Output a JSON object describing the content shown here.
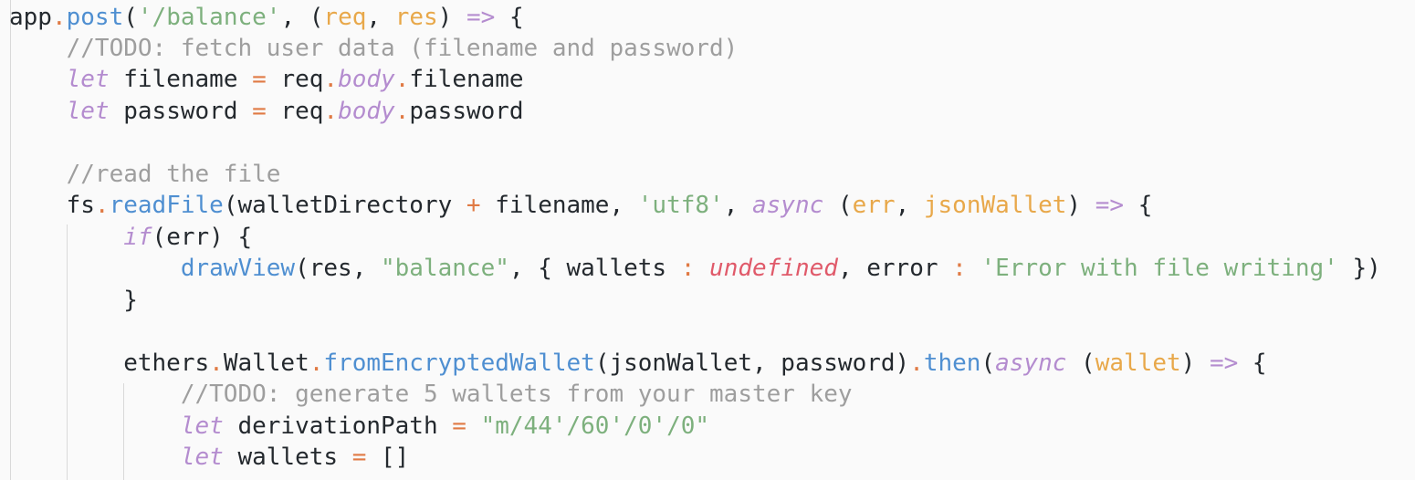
{
  "editor": {
    "lines": [
      {
        "tokens": [
          {
            "t": "app",
            "c": "punct"
          },
          {
            "t": ".",
            "c": "operator"
          },
          {
            "t": "post",
            "c": "function"
          },
          {
            "t": "(",
            "c": "punct"
          },
          {
            "t": "'/balance'",
            "c": "string"
          },
          {
            "t": ", ",
            "c": "punct"
          },
          {
            "t": "(",
            "c": "punct"
          },
          {
            "t": "req",
            "c": "param"
          },
          {
            "t": ", ",
            "c": "punct"
          },
          {
            "t": "res",
            "c": "param"
          },
          {
            "t": ") ",
            "c": "punct"
          },
          {
            "t": "=>",
            "c": "keyword"
          },
          {
            "t": " {",
            "c": "punct"
          }
        ]
      },
      {
        "tokens": [
          {
            "t": "    ",
            "c": "punct"
          },
          {
            "t": "//TODO: fetch user data (filename and password)",
            "c": "comment"
          }
        ]
      },
      {
        "tokens": [
          {
            "t": "    ",
            "c": "punct"
          },
          {
            "t": "let",
            "c": "keyword"
          },
          {
            "t": " filename ",
            "c": "punct"
          },
          {
            "t": "=",
            "c": "operator"
          },
          {
            "t": " req",
            "c": "punct"
          },
          {
            "t": ".",
            "c": "operator"
          },
          {
            "t": "body",
            "c": "prop"
          },
          {
            "t": ".",
            "c": "operator"
          },
          {
            "t": "filename",
            "c": "punct"
          }
        ]
      },
      {
        "tokens": [
          {
            "t": "    ",
            "c": "punct"
          },
          {
            "t": "let",
            "c": "keyword"
          },
          {
            "t": " password ",
            "c": "punct"
          },
          {
            "t": "=",
            "c": "operator"
          },
          {
            "t": " req",
            "c": "punct"
          },
          {
            "t": ".",
            "c": "operator"
          },
          {
            "t": "body",
            "c": "prop"
          },
          {
            "t": ".",
            "c": "operator"
          },
          {
            "t": "password",
            "c": "punct"
          }
        ]
      },
      {
        "tokens": []
      },
      {
        "tokens": [
          {
            "t": "    ",
            "c": "punct"
          },
          {
            "t": "//read the file",
            "c": "comment"
          }
        ]
      },
      {
        "tokens": [
          {
            "t": "    fs",
            "c": "punct"
          },
          {
            "t": ".",
            "c": "operator"
          },
          {
            "t": "readFile",
            "c": "function"
          },
          {
            "t": "(walletDirectory ",
            "c": "punct"
          },
          {
            "t": "+",
            "c": "operator"
          },
          {
            "t": " filename, ",
            "c": "punct"
          },
          {
            "t": "'utf8'",
            "c": "string"
          },
          {
            "t": ", ",
            "c": "punct"
          },
          {
            "t": "async",
            "c": "keyword"
          },
          {
            "t": " (",
            "c": "punct"
          },
          {
            "t": "err",
            "c": "param"
          },
          {
            "t": ", ",
            "c": "punct"
          },
          {
            "t": "jsonWallet",
            "c": "param"
          },
          {
            "t": ") ",
            "c": "punct"
          },
          {
            "t": "=>",
            "c": "keyword"
          },
          {
            "t": " {",
            "c": "punct"
          }
        ]
      },
      {
        "tokens": [
          {
            "t": "        ",
            "c": "punct"
          },
          {
            "t": "if",
            "c": "keyword"
          },
          {
            "t": "(err) {",
            "c": "punct"
          }
        ]
      },
      {
        "tokens": [
          {
            "t": "            ",
            "c": "punct"
          },
          {
            "t": "drawView",
            "c": "function"
          },
          {
            "t": "(res, ",
            "c": "punct"
          },
          {
            "t": "\"balance\"",
            "c": "string"
          },
          {
            "t": ", { wallets ",
            "c": "punct"
          },
          {
            "t": ":",
            "c": "operator"
          },
          {
            "t": " ",
            "c": "punct"
          },
          {
            "t": "undefined",
            "c": "undefined"
          },
          {
            "t": ", error ",
            "c": "punct"
          },
          {
            "t": ":",
            "c": "operator"
          },
          {
            "t": " ",
            "c": "punct"
          },
          {
            "t": "'Error with file writing'",
            "c": "string"
          },
          {
            "t": " })",
            "c": "punct"
          }
        ]
      },
      {
        "tokens": [
          {
            "t": "        }",
            "c": "punct"
          }
        ]
      },
      {
        "tokens": []
      },
      {
        "tokens": [
          {
            "t": "        ethers",
            "c": "punct"
          },
          {
            "t": ".",
            "c": "operator"
          },
          {
            "t": "Wallet",
            "c": "punct"
          },
          {
            "t": ".",
            "c": "operator"
          },
          {
            "t": "fromEncryptedWallet",
            "c": "function"
          },
          {
            "t": "(jsonWallet, password)",
            "c": "punct"
          },
          {
            "t": ".",
            "c": "operator"
          },
          {
            "t": "then",
            "c": "function"
          },
          {
            "t": "(",
            "c": "punct"
          },
          {
            "t": "async",
            "c": "keyword"
          },
          {
            "t": " (",
            "c": "punct"
          },
          {
            "t": "wallet",
            "c": "param"
          },
          {
            "t": ") ",
            "c": "punct"
          },
          {
            "t": "=>",
            "c": "keyword"
          },
          {
            "t": " {",
            "c": "punct"
          }
        ]
      },
      {
        "tokens": [
          {
            "t": "            ",
            "c": "punct"
          },
          {
            "t": "//TODO: generate 5 wallets from your master key",
            "c": "comment"
          }
        ]
      },
      {
        "tokens": [
          {
            "t": "            ",
            "c": "punct"
          },
          {
            "t": "let",
            "c": "keyword"
          },
          {
            "t": " derivationPath ",
            "c": "punct"
          },
          {
            "t": "=",
            "c": "operator"
          },
          {
            "t": " ",
            "c": "punct"
          },
          {
            "t": "\"m/44'/60'/0'/0\"",
            "c": "string"
          }
        ]
      },
      {
        "tokens": [
          {
            "t": "            ",
            "c": "punct"
          },
          {
            "t": "let",
            "c": "keyword"
          },
          {
            "t": " wallets ",
            "c": "punct"
          },
          {
            "t": "=",
            "c": "operator"
          },
          {
            "t": " []",
            "c": "punct"
          }
        ]
      }
    ]
  }
}
